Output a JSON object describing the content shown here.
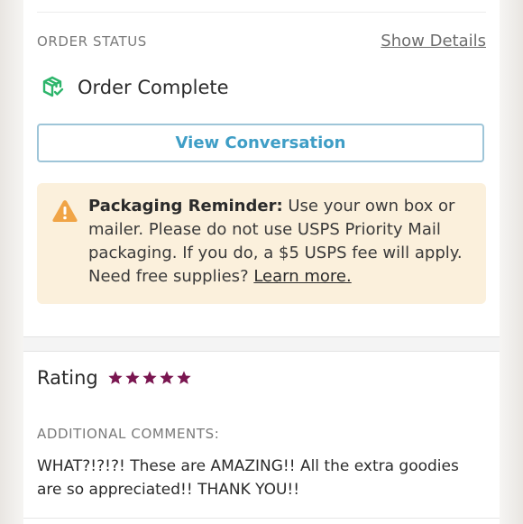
{
  "order_status": {
    "label": "ORDER STATUS",
    "show_details": "Show Details",
    "status_text": "Order Complete",
    "icon": "package-check-icon",
    "accent": "#2db56b"
  },
  "conversation": {
    "button_label": "View Conversation",
    "accent": "#3f9ec6"
  },
  "reminder": {
    "icon": "warning-triangle-icon",
    "title": "Packaging Reminder:",
    "body": " Use your own box or mailer. Please do not use USPS Priority Mail packaging. If you do, a $5 USPS fee will apply. Need free supplies? ",
    "link": "Learn more.",
    "background": "#fbf0dc",
    "icon_color": "#f0a446"
  },
  "rating": {
    "title": "Rating",
    "stars": 5,
    "star_color": "#7a1650"
  },
  "comments": {
    "label": "ADDITIONAL COMMENTS:",
    "text": "WHAT?!?!?! These are AMAZING!! All the extra goodies are so appreciated!! THANK YOU!!"
  }
}
